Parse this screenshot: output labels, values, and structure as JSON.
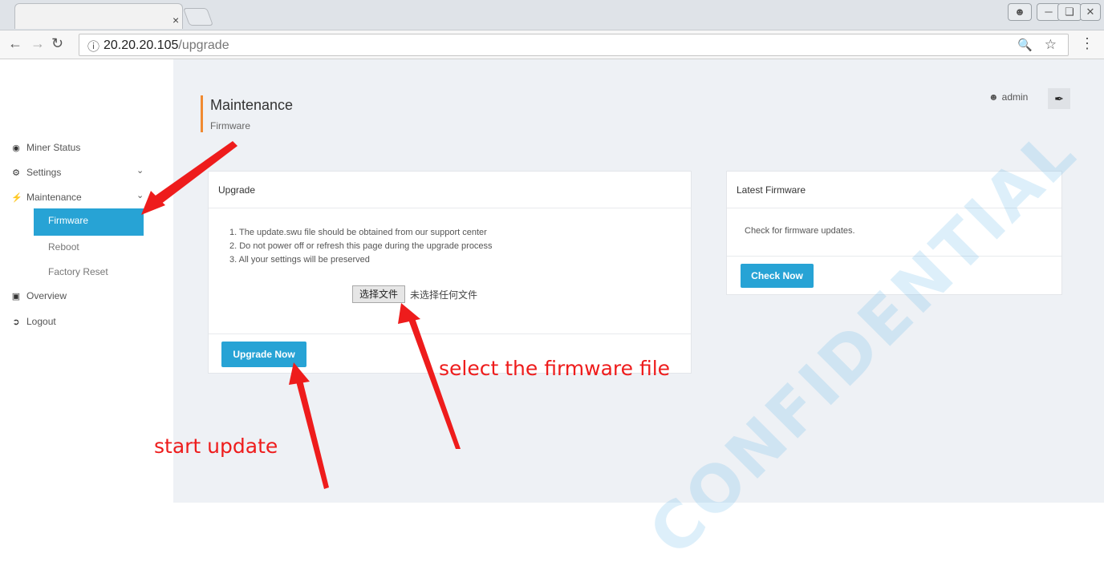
{
  "browser": {
    "tab_close": "×",
    "url_host": "20.20.20.105",
    "url_path": "/upgrade"
  },
  "sidebar": {
    "items": [
      {
        "label": "Miner Status",
        "icon": "gauge-icon"
      },
      {
        "label": "Settings",
        "icon": "cogs-icon"
      },
      {
        "label": "Maintenance",
        "icon": "plug-icon"
      },
      {
        "label": "Overview",
        "icon": "database-icon"
      },
      {
        "label": "Logout",
        "icon": "sign-out-icon"
      }
    ],
    "maintenance_sub": [
      "Firmware",
      "Reboot",
      "Factory Reset"
    ]
  },
  "header": {
    "title": "Maintenance",
    "subtitle": "Firmware",
    "user": "admin",
    "accent_color": "#f08a31"
  },
  "upgrade_panel": {
    "title": "Upgrade",
    "steps": [
      "1. The update.swu file should be obtained from our support center",
      "2. Do not power off or refresh this page during the upgrade process",
      "3. All your settings will be preserved"
    ],
    "file_button": "选择文件",
    "file_status": "未选择任何文件",
    "upgrade_button": "Upgrade Now"
  },
  "latest_panel": {
    "title": "Latest Firmware",
    "text": "Check for firmware updates.",
    "check_button": "Check Now"
  },
  "annotations": {
    "select_file": "select the firmware file",
    "start_update": "start update"
  },
  "colors": {
    "primary": "#27a3d5",
    "annotation": "#ee1c1c"
  }
}
